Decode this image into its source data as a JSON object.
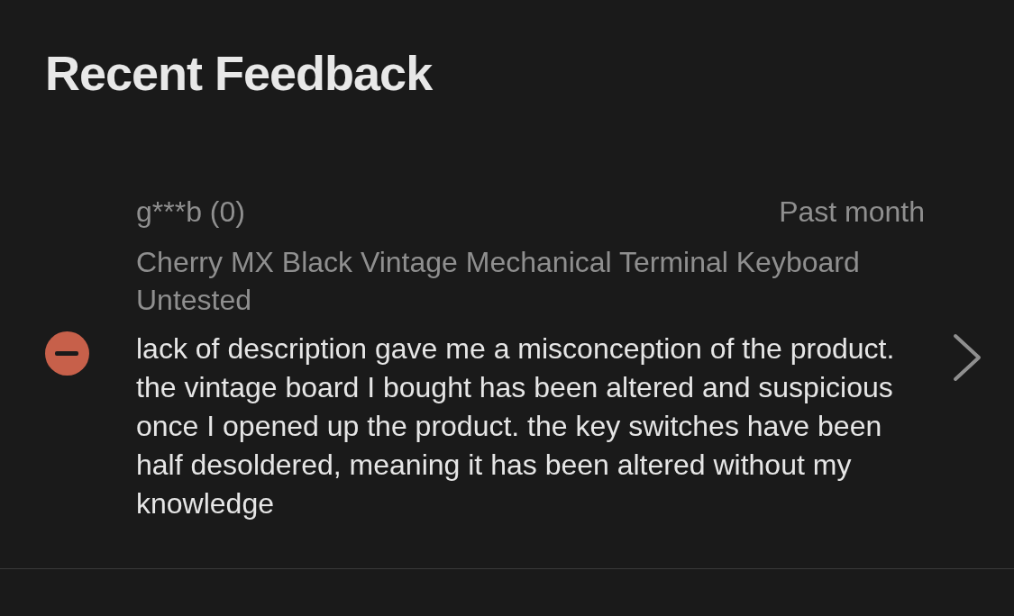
{
  "title": "Recent Feedback",
  "feedback": [
    {
      "kind": "negative",
      "user": "g***b (0)",
      "time": "Past month",
      "item": "Cherry MX Black Vintage Mechanical Terminal Keyboard Untested",
      "comment": "lack of description gave me a misconception of the product. the vintage board I bought has been altered and suspicious once I opened up the product. the key switches have been half desoldered, meaning it has been altered without my knowledge"
    }
  ]
}
